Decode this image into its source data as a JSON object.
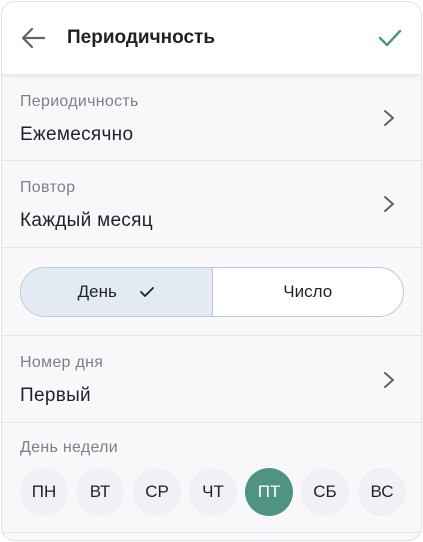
{
  "header": {
    "title": "Периодичность",
    "back_icon": "arrow-left-icon",
    "confirm_icon": "checkmark-icon",
    "accent_color": "#4f9482"
  },
  "rows": {
    "period": {
      "label": "Периодичность",
      "value": "Ежемесячно",
      "icon": "chevron-right-icon"
    },
    "repeat": {
      "label": "Повтор",
      "value": "Каждый месяц",
      "icon": "chevron-right-icon"
    },
    "day_number": {
      "label": "Номер дня",
      "value": "Первый",
      "icon": "chevron-right-icon"
    }
  },
  "mode_toggle": {
    "options": [
      {
        "label": "День",
        "selected": true
      },
      {
        "label": "Число",
        "selected": false
      }
    ],
    "selected_color": "#e3eaf2"
  },
  "weekday": {
    "label": "День недели",
    "days": [
      "ПН",
      "ВТ",
      "СР",
      "ЧТ",
      "ПТ",
      "СБ",
      "ВС"
    ],
    "selected": "ПТ",
    "selected_color": "#4f9482"
  }
}
